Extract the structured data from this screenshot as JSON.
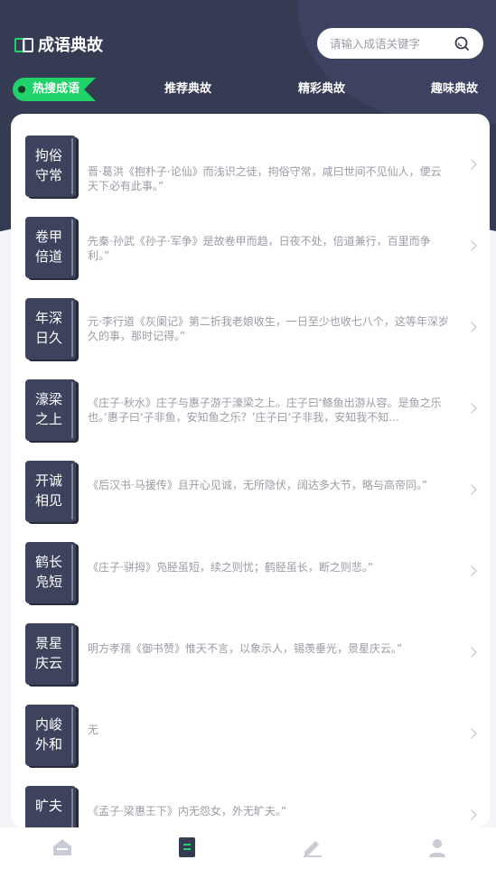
{
  "app": {
    "title": "成语典故"
  },
  "search": {
    "placeholder": "请输入成语关键字"
  },
  "tabs": [
    {
      "label": "热搜成语",
      "active": true
    },
    {
      "label": "推荐典故"
    },
    {
      "label": "精彩典故"
    },
    {
      "label": "趣味典故"
    }
  ],
  "idioms": [
    {
      "name": "拘俗守常",
      "desc": "晋·葛洪《抱朴子·论仙》而浅识之徒，拘俗守常，咸曰世间不见仙人，便云天下必有此事。”"
    },
    {
      "name": "卷甲倍道",
      "desc": "先秦·孙武《孙子·军争》是故卷甲而趋，日夜不处，倍道兼行，百里而争利。”"
    },
    {
      "name": "年深日久",
      "desc": "元·李行道《灰阑记》第二折我老娘收生，一日至少也收七八个，这等年深岁久的事，那时记得。”"
    },
    {
      "name": "濠梁之上",
      "desc": "《庄子·秋水》庄子与惠子游于濠梁之上。庄子曰‘鲦鱼出游从容。是鱼之乐也。’惠子曰‘子非鱼，安知鱼之乐？’庄子曰‘子非我，安知我不知..."
    },
    {
      "name": "开诚相见",
      "desc": "《后汉书·马援传》且开心见诚，无所隐伏，阔达多大节，略与高帝同。”"
    },
    {
      "name": "鹤长凫短",
      "desc": "《庄子·骈拇》凫胫虽短，续之则忧；鹤胫虽长，断之则悲。”"
    },
    {
      "name": "景星庆云",
      "desc": "明方孝孺《御书赞》惟天不言，以象示人，锡羡垂光，景星庆云。”"
    },
    {
      "name": "内峻外和",
      "desc": "无"
    },
    {
      "name": "旷夫",
      "desc": "《孟子·梁惠王下》内无怨女，外无旷夫。”"
    }
  ],
  "colors": {
    "header": "#353b53",
    "accent": "#1fd26a",
    "seal": "#3d435c",
    "muted": "#9a9ca6"
  },
  "bottom_nav": [
    {
      "icon": "home-icon",
      "active": false
    },
    {
      "icon": "book-icon",
      "active": true
    },
    {
      "icon": "edit-icon",
      "active": false
    },
    {
      "icon": "user-icon",
      "active": false
    }
  ]
}
